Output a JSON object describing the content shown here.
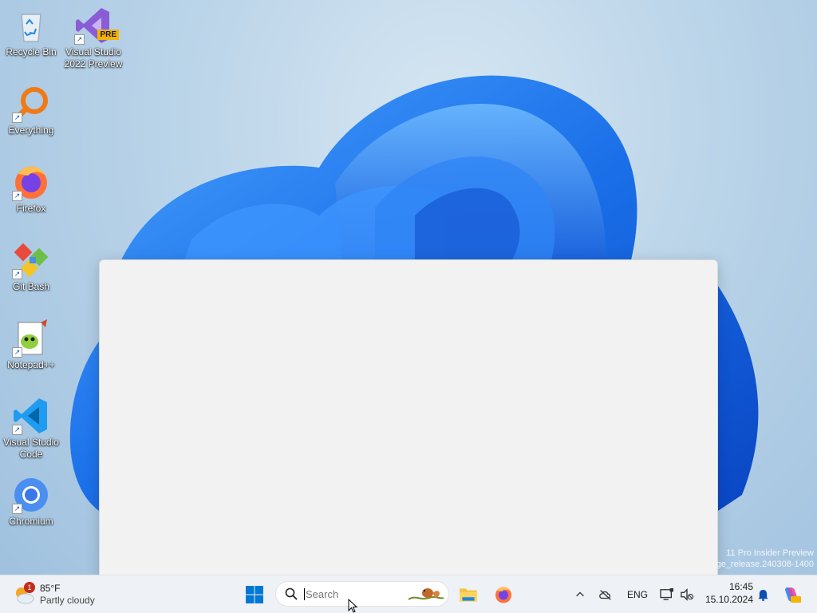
{
  "desktop": {
    "icons": [
      {
        "label": "Recycle Bin",
        "icon": "recycle-bin-icon"
      },
      {
        "label": "Visual Studio 2022 Preview",
        "icon": "visual-studio-preview-icon",
        "badge": "PRE"
      },
      {
        "label": "Everything",
        "icon": "everything-search-icon"
      },
      {
        "label": "Firefox",
        "icon": "firefox-icon"
      },
      {
        "label": "Git Bash",
        "icon": "git-bash-icon"
      },
      {
        "label": "Notepad++",
        "icon": "notepad-plus-plus-icon"
      },
      {
        "label": "Visual Studio Code",
        "icon": "vscode-icon"
      },
      {
        "label": "Chromium",
        "icon": "chromium-icon"
      }
    ]
  },
  "watermark": {
    "line1": "11 Pro Insider Preview",
    "line2": "ge_release.240308-1400"
  },
  "taskbar": {
    "weather": {
      "temp": "85°F",
      "condition": "Partly cloudy",
      "badge": "1"
    },
    "search": {
      "placeholder": "Search"
    },
    "tray": {
      "language": "ENG"
    },
    "clock": {
      "time": "16:45",
      "date": "15.10.2024"
    }
  },
  "colors": {
    "accent": "#0078d4",
    "wallpaper_bloom": "#1a6fe8",
    "window_bg": "#f2f2f2",
    "taskbar_bg": "#eef1f5"
  }
}
